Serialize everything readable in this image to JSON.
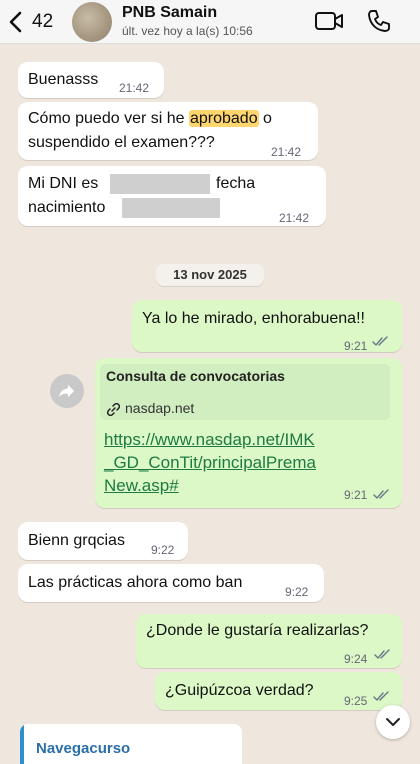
{
  "header": {
    "back_count": "42",
    "contact_name": "PNB Samain",
    "last_seen": "últ. vez hoy a la(s) 10:56"
  },
  "messages": [
    {
      "text": "Buenasss",
      "time": "21:42"
    },
    {
      "pre": "Cómo puedo ver si he ",
      "highlight": "aprobado",
      "post": " o",
      "line2": "suspendido el examen???",
      "time": "21:42"
    },
    {
      "part1": "Mi DNI es",
      "part2": "fecha",
      "part3": "nacimiento",
      "time": "21:42"
    },
    {
      "text": "Ya lo he mirado, enhorabuena!!",
      "time": "9:21"
    },
    {
      "link_title": "Consulta de convocatorias",
      "link_domain": "nasdap.net",
      "url": "https://www.nasdap.net/IMK_GD_ConTit/principalPremaNew.asp#",
      "time": "9:21"
    },
    {
      "text": "Bienn grqcias",
      "time": "9:22"
    },
    {
      "text": "Las prácticas ahora como ban",
      "time": "9:22"
    },
    {
      "text": "¿Donde le gustaría realizarlas?",
      "time": "9:24"
    },
    {
      "text": "¿Guipúzcoa verdad?",
      "time": "9:25"
    }
  ],
  "date_separator": "13 nov 2025",
  "bottom_card": {
    "label": "Navegacurso"
  },
  "colors": {
    "incoming": "#ffffff",
    "outgoing": "#dcf8c6",
    "link": "#1e7a43",
    "tick": "#667788"
  },
  "icons": [
    "chevron-left-icon",
    "video-camera-icon",
    "phone-icon",
    "forward-icon",
    "link-icon",
    "double-check-icon",
    "chevron-down-icon"
  ]
}
